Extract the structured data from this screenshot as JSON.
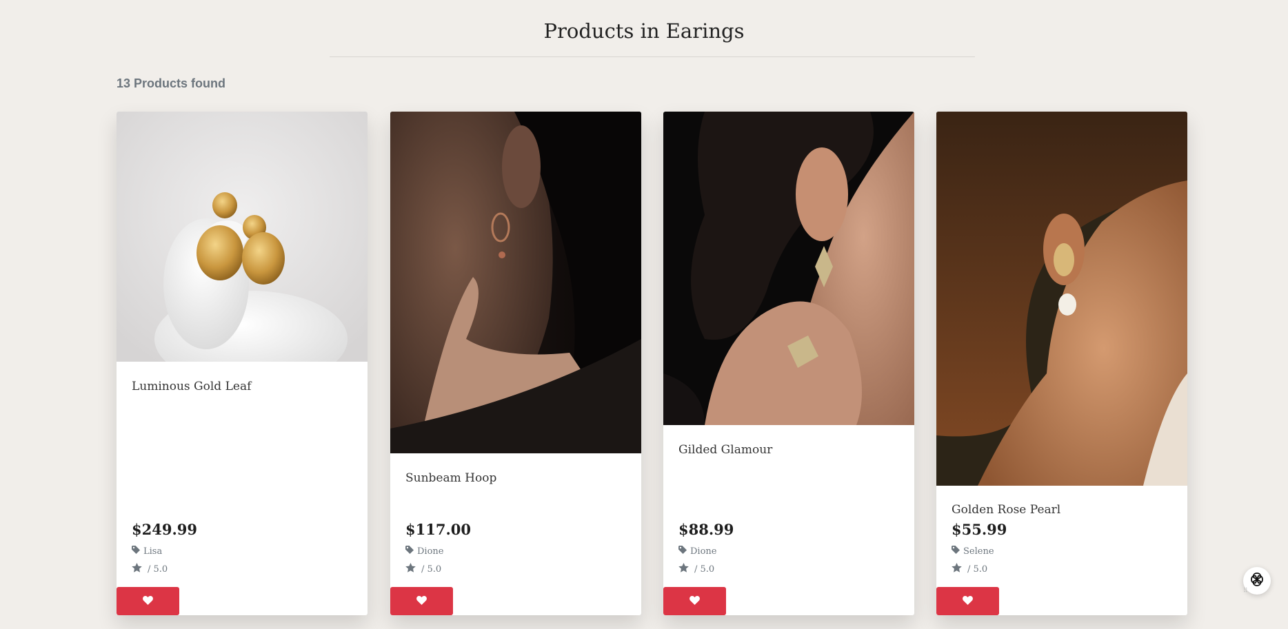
{
  "page": {
    "title": "Products in Earings",
    "products_found": "13 Products found"
  },
  "products": [
    {
      "name": "Luminous Gold Leaf",
      "price": "$249.99",
      "brand": "Lisa",
      "rating": "/ 5.0"
    },
    {
      "name": "Sunbeam Hoop",
      "price": "$117.00",
      "brand": "Dione",
      "rating": "/ 5.0"
    },
    {
      "name": "Gilded Glamour",
      "price": "$88.99",
      "brand": "Dione",
      "rating": "/ 5.0"
    },
    {
      "name": "Golden Rose Pearl",
      "price": "$55.99",
      "brand": "Selene",
      "rating": "/ 5.0"
    }
  ],
  "icons": {
    "brand": "tag-icon",
    "rating": "star-icon",
    "favorite": "heart-icon",
    "widget": "assistant-logo-icon"
  },
  "colors": {
    "background": "#f1eeea",
    "favorite_button": "#dc3545",
    "muted_text": "#6c757d"
  }
}
